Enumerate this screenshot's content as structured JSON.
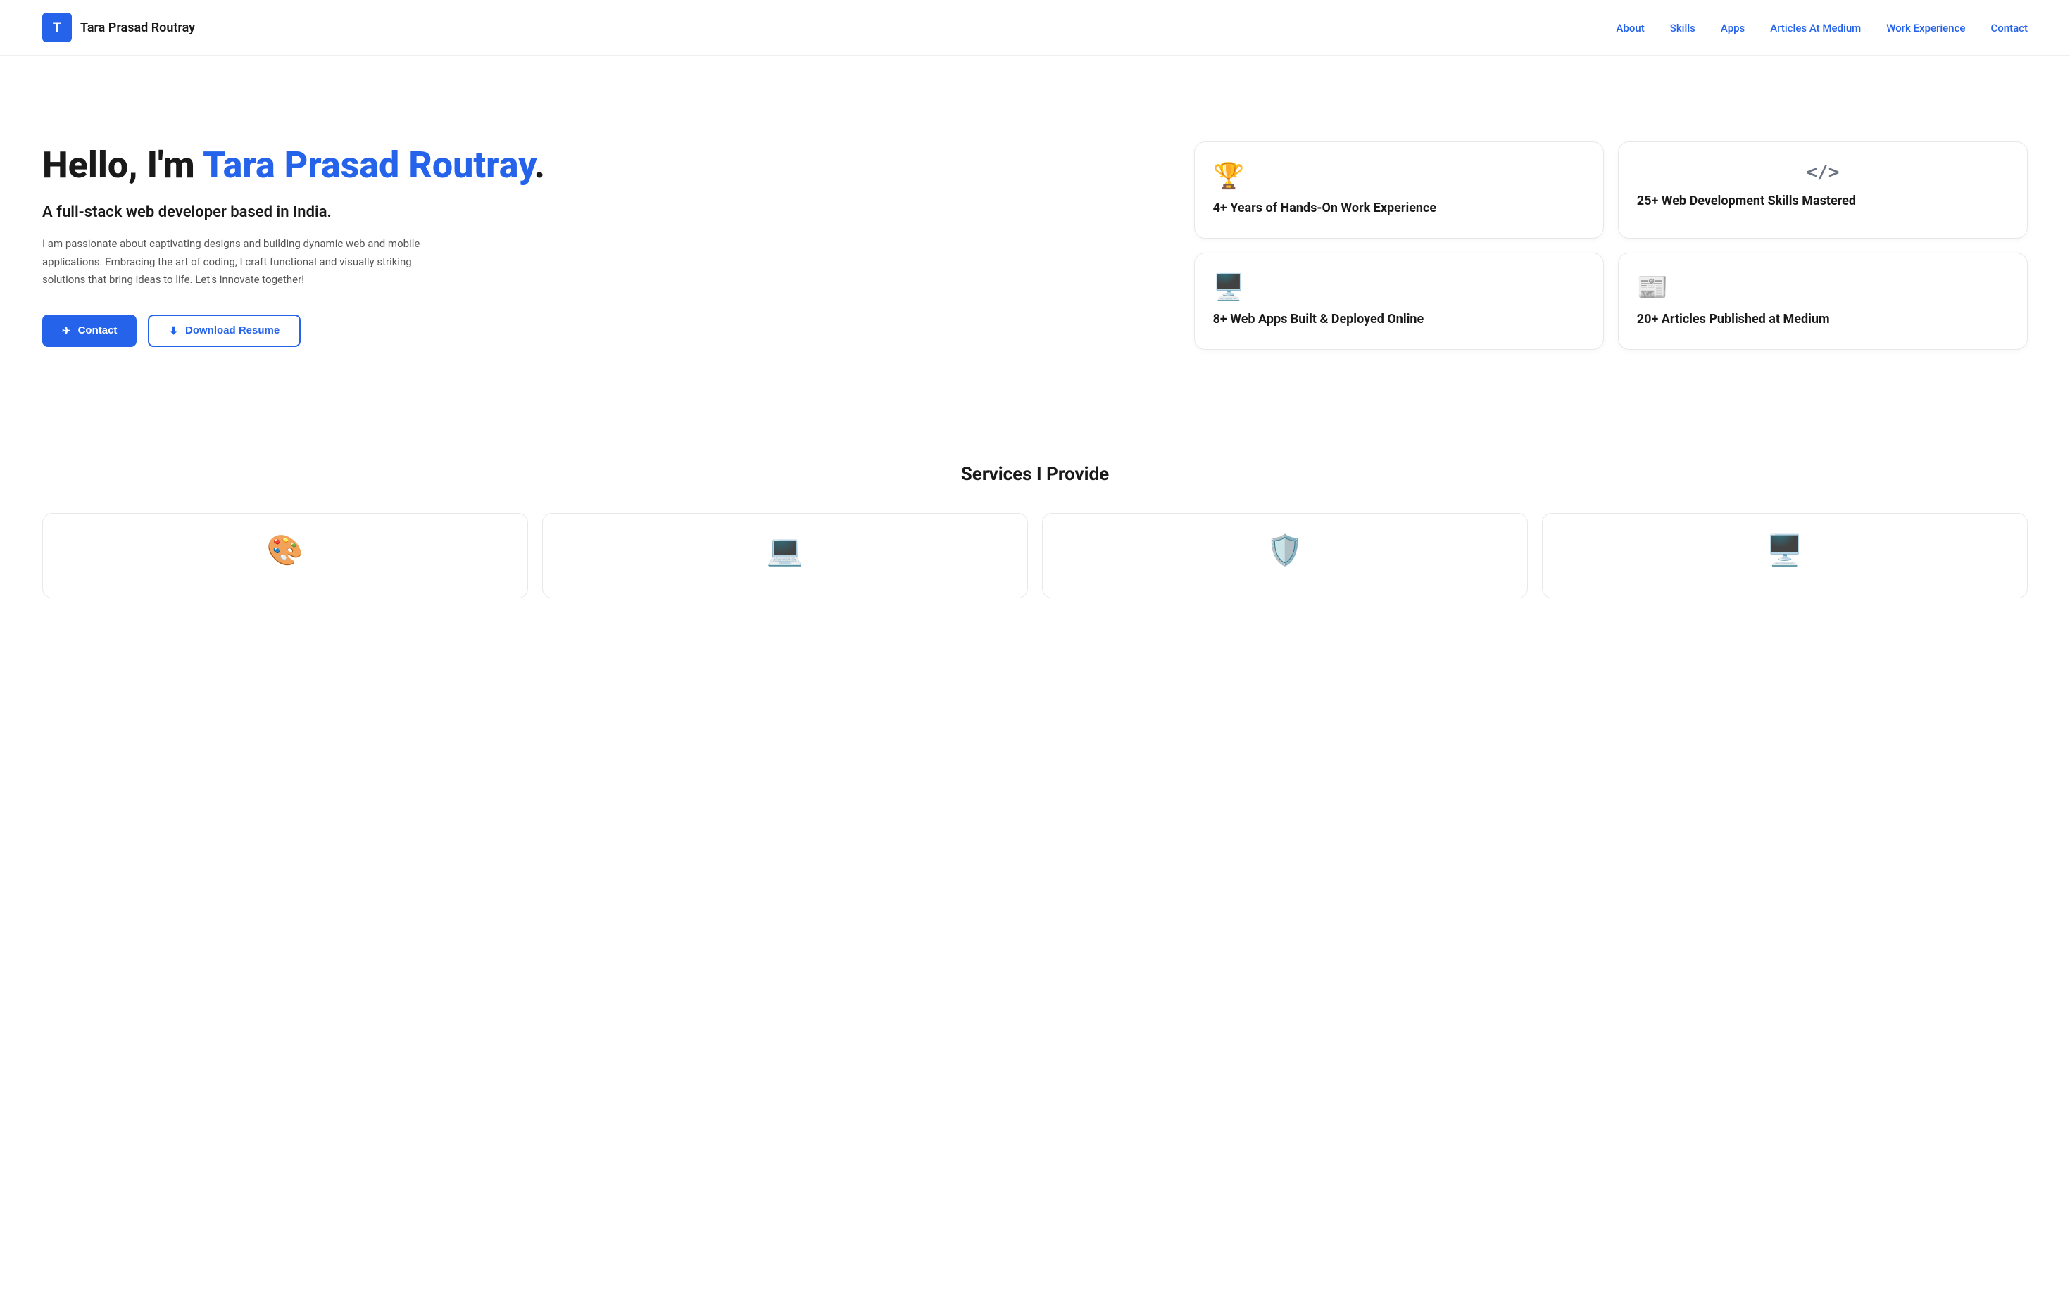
{
  "nav": {
    "logo_letter": "T",
    "brand_name": "Tara Prasad Routray",
    "links": [
      {
        "label": "About",
        "href": "#about"
      },
      {
        "label": "Skills",
        "href": "#skills"
      },
      {
        "label": "Apps",
        "href": "#apps"
      },
      {
        "label": "Articles At Medium",
        "href": "#articles"
      },
      {
        "label": "Work Experience",
        "href": "#experience"
      },
      {
        "label": "Contact",
        "href": "#contact"
      }
    ]
  },
  "hero": {
    "greeting": "Hello, I'm ",
    "name": "Tara Prasad Routray",
    "period": ".",
    "subtitle": "A full-stack web developer based in India.",
    "description": "I am passionate about captivating designs and building dynamic web and mobile applications. Embracing the art of coding, I craft functional and visually striking solutions that bring ideas to life. Let's innovate together!",
    "btn_contact": "Contact",
    "btn_resume": "Download Resume"
  },
  "stats": [
    {
      "icon": "🏆",
      "text": "4+ Years of Hands-On Work Experience",
      "icon_name": "trophy-icon"
    },
    {
      "icon": "</>",
      "text": "25+ Web Development Skills Mastered",
      "icon_name": "code-icon"
    },
    {
      "icon": "🖥️",
      "text": "8+ Web Apps Built & Deployed Online",
      "icon_name": "web-apps-icon"
    },
    {
      "icon": "📰",
      "text": "20+ Articles Published at Medium",
      "icon_name": "articles-icon"
    }
  ],
  "services": {
    "title": "Services I Provide",
    "items": [
      {
        "icon": "🎨",
        "icon_name": "design-icon"
      },
      {
        "icon": "💻",
        "icon_name": "dev-icon"
      },
      {
        "icon": "🛡️",
        "icon_name": "security-icon"
      },
      {
        "icon": "🖥️",
        "icon_name": "deploy-icon"
      }
    ]
  }
}
